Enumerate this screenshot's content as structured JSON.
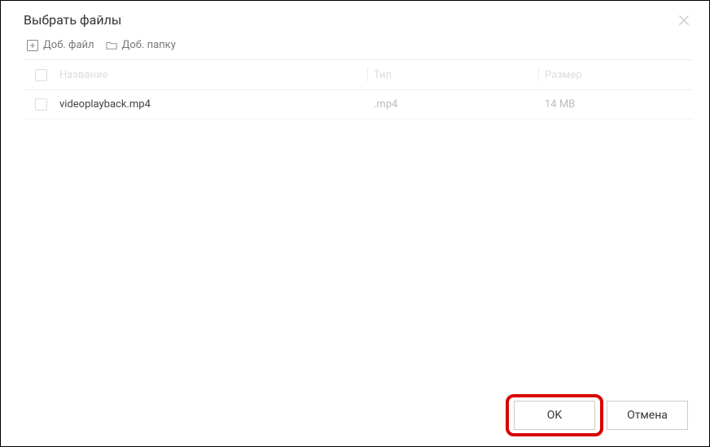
{
  "title": "Выбрать файлы",
  "toolbar": {
    "add_file": "Доб. файл",
    "add_folder": "Доб. папку"
  },
  "columns": {
    "name": "Название",
    "type": "Тип",
    "size": "Размер"
  },
  "rows": [
    {
      "name": "videoplayback.mp4",
      "type": ".mp4",
      "size": "14 MB"
    }
  ],
  "footer": {
    "ok": "OK",
    "cancel": "Отмена"
  }
}
